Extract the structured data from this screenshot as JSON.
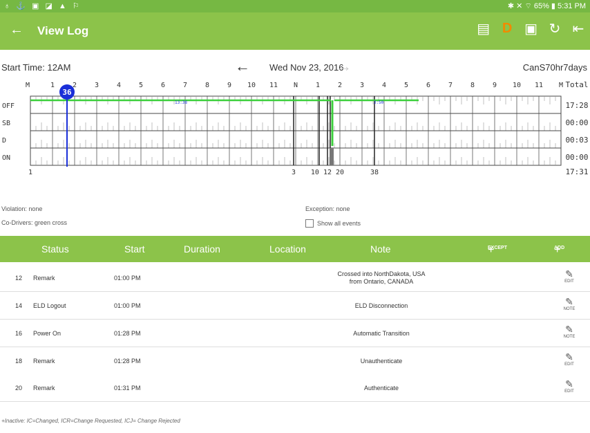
{
  "statusbar": {
    "left_icons": "♁ ⚓ ▣ ◪ ▲ ⚐",
    "right_text": "✱ ✕ ⌔ 65% ▮ 5:31 PM"
  },
  "appbar": {
    "title": "View Log"
  },
  "toolbar": {
    "start_time": "Start Time: 12AM",
    "date": "Wed Nov 23, 2016",
    "ruleset": "CanS70hr7days"
  },
  "graph": {
    "hour_labels": [
      "M",
      "1",
      "2",
      "3",
      "4",
      "5",
      "6",
      "7",
      "8",
      "9",
      "10",
      "11",
      "N",
      "1",
      "2",
      "3",
      "4",
      "5",
      "6",
      "7",
      "8",
      "9",
      "10",
      "11",
      "M"
    ],
    "total_header": "Total",
    "status_rows": [
      "OFF",
      "SB",
      "D",
      "ON"
    ],
    "row_totals": [
      "17:28",
      "00:00",
      "00:03",
      "00:00"
    ],
    "grand_total": "17:31",
    "marker_label": "36",
    "annotation_1": "13:38",
    "annotation_2": "3:50",
    "bottom_labels": {
      "l1": "1",
      "l2": "3",
      "l3": "10 12 20",
      "l4": "38"
    }
  },
  "info": {
    "violation": "Violation: none",
    "codrivers": "Co-Drivers: green cross",
    "exception": "Exception: none",
    "show_all": "Show all events"
  },
  "table": {
    "headers": {
      "status": "Status",
      "start": "Start",
      "duration": "Duration",
      "location": "Location",
      "note": "Note",
      "except": "EXCEPT",
      "add": "ADD"
    },
    "rows": [
      {
        "idx": "12",
        "status": "Remark",
        "start": "01:00 PM",
        "note1": "Crossed into NorthDakota, USA",
        "note2": "from Ontario, CANADA",
        "action": "EDIT"
      },
      {
        "idx": "14",
        "status": "ELD Logout",
        "start": "01:00 PM",
        "note1": "ELD Disconnection",
        "note2": "",
        "action": "NOTE"
      },
      {
        "idx": "16",
        "status": "Power On",
        "start": "01:28 PM",
        "note1": "Automatic Transition",
        "note2": "",
        "action": "NOTE"
      },
      {
        "idx": "18",
        "status": "Remark",
        "start": "01:28 PM",
        "note1": "Unauthenticate",
        "note2": "",
        "action": "EDIT"
      },
      {
        "idx": "20",
        "status": "Remark",
        "start": "01:31 PM",
        "note1": "Authenticate",
        "note2": "",
        "action": "EDIT"
      }
    ]
  },
  "footnote": "+Inactive: IC=Changed, ICR=Change Requested, ICJ= Change Rejected",
  "colors": {
    "appbar": "#8cc34a",
    "off_line": "#3ccf3c",
    "marker": "#1a2fd8",
    "accent": "#f28a00"
  }
}
